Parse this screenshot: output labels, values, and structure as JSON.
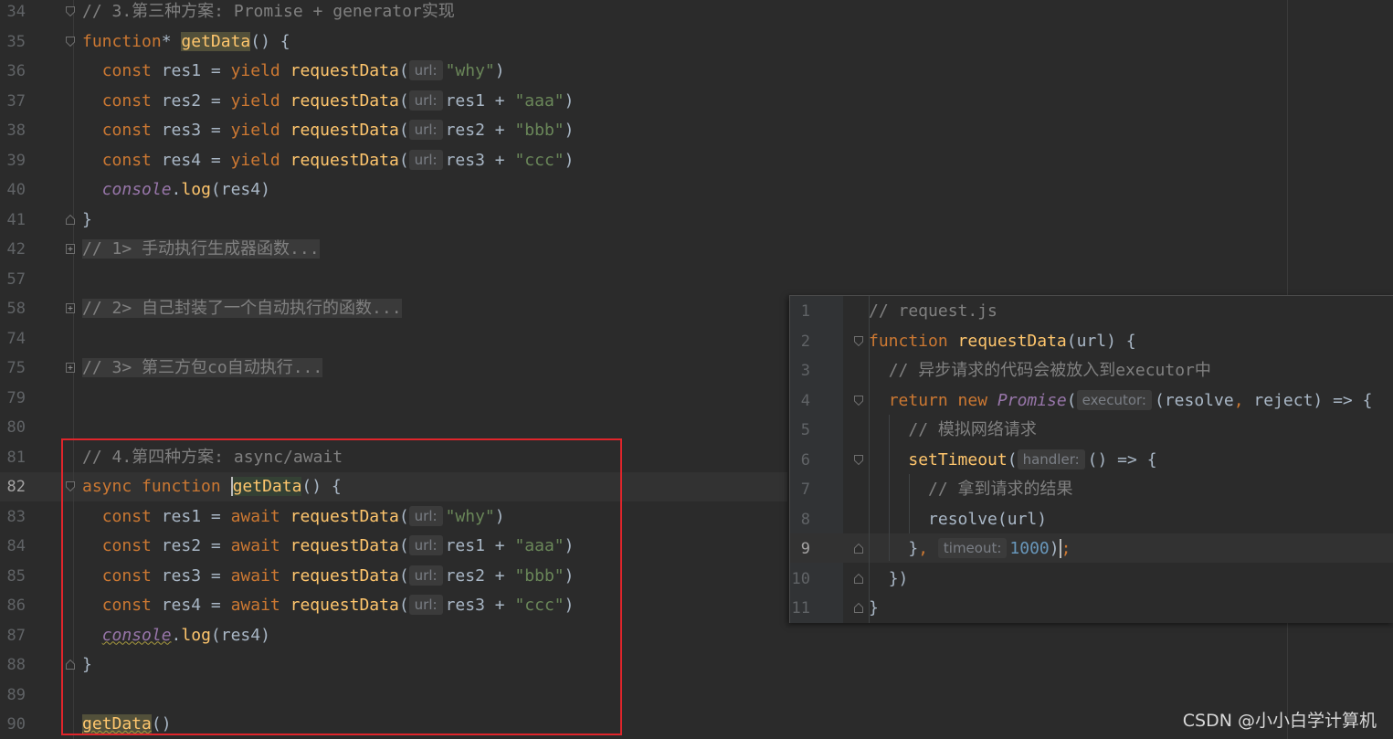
{
  "main_editor": {
    "lines": [
      {
        "n": "34",
        "tokens": [
          {
            "c": "cm",
            "t": "// 3.第三种方案: Promise + generator实现"
          }
        ]
      },
      {
        "n": "35",
        "tokens": [
          {
            "c": "kw",
            "t": "function"
          },
          {
            "t": "* "
          },
          {
            "c": "fn hl-read",
            "t": "getData"
          },
          {
            "t": "() {"
          }
        ]
      },
      {
        "n": "36",
        "tokens": [
          {
            "t": "  "
          },
          {
            "c": "kw",
            "t": "const "
          },
          {
            "t": "res1 = "
          },
          {
            "c": "kw",
            "t": "yield "
          },
          {
            "c": "fn",
            "t": "requestData"
          },
          {
            "t": "("
          },
          {
            "c": "hint",
            "t": "url:"
          },
          {
            "c": "str",
            "t": "\"why\""
          },
          {
            "t": ")"
          }
        ]
      },
      {
        "n": "37",
        "tokens": [
          {
            "t": "  "
          },
          {
            "c": "kw",
            "t": "const "
          },
          {
            "t": "res2 = "
          },
          {
            "c": "kw",
            "t": "yield "
          },
          {
            "c": "fn",
            "t": "requestData"
          },
          {
            "t": "("
          },
          {
            "c": "hint",
            "t": "url:"
          },
          {
            "t": "res1 + "
          },
          {
            "c": "str",
            "t": "\"aaa\""
          },
          {
            "t": ")"
          }
        ]
      },
      {
        "n": "38",
        "tokens": [
          {
            "t": "  "
          },
          {
            "c": "kw",
            "t": "const "
          },
          {
            "t": "res3 = "
          },
          {
            "c": "kw",
            "t": "yield "
          },
          {
            "c": "fn",
            "t": "requestData"
          },
          {
            "t": "("
          },
          {
            "c": "hint",
            "t": "url:"
          },
          {
            "t": "res2 + "
          },
          {
            "c": "str",
            "t": "\"bbb\""
          },
          {
            "t": ")"
          }
        ]
      },
      {
        "n": "39",
        "tokens": [
          {
            "t": "  "
          },
          {
            "c": "kw",
            "t": "const "
          },
          {
            "t": "res4 = "
          },
          {
            "c": "kw",
            "t": "yield "
          },
          {
            "c": "fn",
            "t": "requestData"
          },
          {
            "t": "("
          },
          {
            "c": "hint",
            "t": "url:"
          },
          {
            "t": "res3 + "
          },
          {
            "c": "str",
            "t": "\"ccc\""
          },
          {
            "t": ")"
          }
        ]
      },
      {
        "n": "40",
        "tokens": [
          {
            "t": "  "
          },
          {
            "c": "gl",
            "t": "console"
          },
          {
            "t": "."
          },
          {
            "c": "fn",
            "t": "log"
          },
          {
            "t": "(res4)"
          }
        ]
      },
      {
        "n": "41",
        "tokens": [
          {
            "t": "}"
          }
        ]
      },
      {
        "n": "42",
        "tokens": [
          {
            "c": "cm folded",
            "t": "// 1> 手动执行生成器函数..."
          }
        ]
      },
      {
        "n": "57",
        "tokens": []
      },
      {
        "n": "58",
        "tokens": [
          {
            "c": "cm folded",
            "t": "// 2> 自己封装了一个自动执行的函数..."
          }
        ]
      },
      {
        "n": "74",
        "tokens": []
      },
      {
        "n": "75",
        "tokens": [
          {
            "c": "cm folded",
            "t": "// 3> 第三方包co自动执行..."
          }
        ]
      },
      {
        "n": "79",
        "tokens": []
      },
      {
        "n": "80",
        "tokens": []
      },
      {
        "n": "81",
        "tokens": [
          {
            "c": "cm",
            "t": "// 4.第四种方案: async/await"
          }
        ]
      },
      {
        "n": "82",
        "tokens": [
          {
            "c": "kw",
            "t": "async function "
          },
          {
            "c": "fn hl-usage caret",
            "t": "getData"
          },
          {
            "t": "() {"
          }
        ]
      },
      {
        "n": "83",
        "tokens": [
          {
            "t": "  "
          },
          {
            "c": "kw",
            "t": "const "
          },
          {
            "t": "res1 = "
          },
          {
            "c": "kw",
            "t": "await "
          },
          {
            "c": "fn",
            "t": "requestData"
          },
          {
            "t": "("
          },
          {
            "c": "hint",
            "t": "url:"
          },
          {
            "c": "str",
            "t": "\"why\""
          },
          {
            "t": ")"
          }
        ]
      },
      {
        "n": "84",
        "tokens": [
          {
            "t": "  "
          },
          {
            "c": "kw",
            "t": "const "
          },
          {
            "t": "res2 = "
          },
          {
            "c": "kw",
            "t": "await "
          },
          {
            "c": "fn",
            "t": "requestData"
          },
          {
            "t": "("
          },
          {
            "c": "hint",
            "t": "url:"
          },
          {
            "t": "res1 + "
          },
          {
            "c": "str",
            "t": "\"aaa\""
          },
          {
            "t": ")"
          }
        ]
      },
      {
        "n": "85",
        "tokens": [
          {
            "t": "  "
          },
          {
            "c": "kw",
            "t": "const "
          },
          {
            "t": "res3 = "
          },
          {
            "c": "kw",
            "t": "await "
          },
          {
            "c": "fn",
            "t": "requestData"
          },
          {
            "t": "("
          },
          {
            "c": "hint",
            "t": "url:"
          },
          {
            "t": "res2 + "
          },
          {
            "c": "str",
            "t": "\"bbb\""
          },
          {
            "t": ")"
          }
        ]
      },
      {
        "n": "86",
        "tokens": [
          {
            "t": "  "
          },
          {
            "c": "kw",
            "t": "const "
          },
          {
            "t": "res4 = "
          },
          {
            "c": "kw",
            "t": "await "
          },
          {
            "c": "fn",
            "t": "requestData"
          },
          {
            "t": "("
          },
          {
            "c": "hint",
            "t": "url:"
          },
          {
            "t": "res3 + "
          },
          {
            "c": "str",
            "t": "\"ccc\""
          },
          {
            "t": ")"
          }
        ]
      },
      {
        "n": "87",
        "tokens": [
          {
            "t": "  "
          },
          {
            "c": "gl wavy",
            "t": "console"
          },
          {
            "t": "."
          },
          {
            "c": "fn",
            "t": "log"
          },
          {
            "t": "(res4)"
          }
        ]
      },
      {
        "n": "88",
        "tokens": [
          {
            "t": "}"
          }
        ]
      },
      {
        "n": "89",
        "tokens": []
      },
      {
        "n": "90",
        "tokens": [
          {
            "c": "fn wavy hl-read",
            "t": "getData"
          },
          {
            "t": "()"
          }
        ]
      }
    ],
    "current_line": "82"
  },
  "popup_editor": {
    "lines": [
      {
        "n": "1",
        "tokens": [
          {
            "c": "cm",
            "t": "// request.js"
          }
        ]
      },
      {
        "n": "2",
        "tokens": [
          {
            "c": "kw",
            "t": "function "
          },
          {
            "c": "fn",
            "t": "requestData"
          },
          {
            "t": "(url) {"
          }
        ]
      },
      {
        "n": "3",
        "tokens": [
          {
            "t": "  "
          },
          {
            "c": "cm",
            "t": "// 异步请求的代码会被放入到executor中"
          }
        ]
      },
      {
        "n": "4",
        "tokens": [
          {
            "t": "  "
          },
          {
            "c": "kw",
            "t": "return new "
          },
          {
            "c": "gl",
            "t": "Promise"
          },
          {
            "t": "("
          },
          {
            "c": "hint",
            "t": "executor:"
          },
          {
            "t": "(resolve"
          },
          {
            "c": "kw",
            "t": ", "
          },
          {
            "t": "reject) => {"
          }
        ]
      },
      {
        "n": "5",
        "tokens": [
          {
            "t": "    "
          },
          {
            "c": "cm",
            "t": "// 模拟网络请求"
          }
        ]
      },
      {
        "n": "6",
        "tokens": [
          {
            "t": "    "
          },
          {
            "c": "fn",
            "t": "setTimeout"
          },
          {
            "t": "("
          },
          {
            "c": "hint",
            "t": "handler:"
          },
          {
            "t": "() => {"
          }
        ]
      },
      {
        "n": "7",
        "tokens": [
          {
            "t": "      "
          },
          {
            "c": "cm",
            "t": "// 拿到请求的结果"
          }
        ]
      },
      {
        "n": "8",
        "tokens": [
          {
            "t": "      "
          },
          {
            "t": "resolve(url)"
          }
        ]
      },
      {
        "n": "9",
        "tokens": [
          {
            "t": "    "
          },
          {
            "t": "}"
          },
          {
            "c": "kw",
            "t": ", "
          },
          {
            "c": "hint",
            "t": "timeout:"
          },
          {
            "c": "num",
            "t": "1000"
          },
          {
            "t": ")"
          },
          {
            "c": "kw caret",
            "t": ";"
          }
        ]
      },
      {
        "n": "10",
        "tokens": [
          {
            "t": "  "
          },
          {
            "t": "})"
          }
        ]
      },
      {
        "n": "11",
        "tokens": [
          {
            "t": "}"
          }
        ]
      }
    ],
    "current_line": "9"
  },
  "watermark": "CSDN @小小白学计算机",
  "colors": {
    "background": "#2b2b2b",
    "keyword": "#cc7832",
    "function": "#ffc66d",
    "string": "#6a8759",
    "number": "#6897bb",
    "comment": "#808080",
    "global": "#9876aa",
    "annotation_box": "#e0252b"
  }
}
